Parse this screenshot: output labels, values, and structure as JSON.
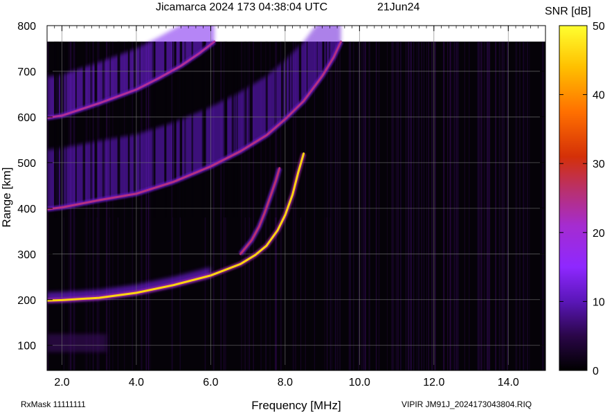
{
  "chart_data": {
    "type": "heatmap",
    "title": "Jicamarca 2024 173 04:38:04 UTC",
    "date_label": "21Jun24",
    "xlabel": "Frequency [MHz]",
    "ylabel": "Range [km]",
    "xlim": [
      1.6,
      15.0
    ],
    "ylim": [
      45,
      800
    ],
    "x_ticks": [
      "2.0",
      "4.0",
      "6.0",
      "8.0",
      "10.0",
      "12.0",
      "14.0"
    ],
    "x_tick_values": [
      2.0,
      4.0,
      6.0,
      8.0,
      10.0,
      12.0,
      14.0
    ],
    "y_ticks": [
      "100",
      "200",
      "300",
      "400",
      "500",
      "600",
      "700",
      "800"
    ],
    "y_tick_values": [
      100,
      200,
      300,
      400,
      500,
      600,
      700,
      800
    ],
    "grid": true,
    "data_top_range": 765,
    "colorbar": {
      "label": "SNR [dB]",
      "min": 0,
      "max": 50,
      "ticks": [
        "0",
        "10",
        "20",
        "30",
        "40",
        "50"
      ],
      "tick_values": [
        0,
        10,
        20,
        30,
        40,
        50
      ],
      "colors": [
        "#000000",
        "#3a0a5e",
        "#7a1fe0",
        "#9a2cff",
        "#b0308a",
        "#d0300a",
        "#ff8000",
        "#ffd000",
        "#ffff30"
      ]
    },
    "traces": [
      {
        "name": "",
        "snr": 46,
        "points": [
          [
            1.6,
            198
          ],
          [
            2.0,
            199
          ],
          [
            3.0,
            204
          ],
          [
            4.0,
            215
          ],
          [
            5.0,
            232
          ],
          [
            6.0,
            253
          ],
          [
            6.8,
            278
          ],
          [
            7.2,
            298
          ],
          [
            7.5,
            318
          ],
          [
            7.8,
            352
          ],
          [
            8.0,
            385
          ],
          [
            8.2,
            430
          ],
          [
            8.35,
            478
          ],
          [
            8.5,
            520
          ]
        ]
      },
      {
        "name": "",
        "snr": 26,
        "points": [
          [
            6.8,
            300
          ],
          [
            7.1,
            330
          ],
          [
            7.3,
            360
          ],
          [
            7.45,
            390
          ],
          [
            7.6,
            425
          ],
          [
            7.75,
            460
          ],
          [
            7.85,
            488
          ]
        ]
      },
      {
        "name": "",
        "snr": 25,
        "points": [
          [
            1.6,
            398
          ],
          [
            2.0,
            402
          ],
          [
            3.0,
            418
          ],
          [
            4.0,
            432
          ],
          [
            5.0,
            458
          ],
          [
            6.0,
            492
          ],
          [
            6.8,
            525
          ],
          [
            7.5,
            560
          ],
          [
            8.0,
            595
          ],
          [
            8.5,
            635
          ],
          [
            9.0,
            690
          ],
          [
            9.3,
            730
          ],
          [
            9.5,
            765
          ]
        ]
      },
      {
        "name": "",
        "snr": 24,
        "points": [
          [
            1.6,
            598
          ],
          [
            2.0,
            603
          ],
          [
            3.0,
            630
          ],
          [
            4.0,
            660
          ],
          [
            4.6,
            685
          ],
          [
            5.2,
            712
          ],
          [
            5.7,
            740
          ],
          [
            6.1,
            765
          ]
        ]
      }
    ]
  },
  "footer": {
    "rxmask": "RxMask 11111111",
    "file": "VIPIR  JM91J_2024173043804.RIQ"
  }
}
